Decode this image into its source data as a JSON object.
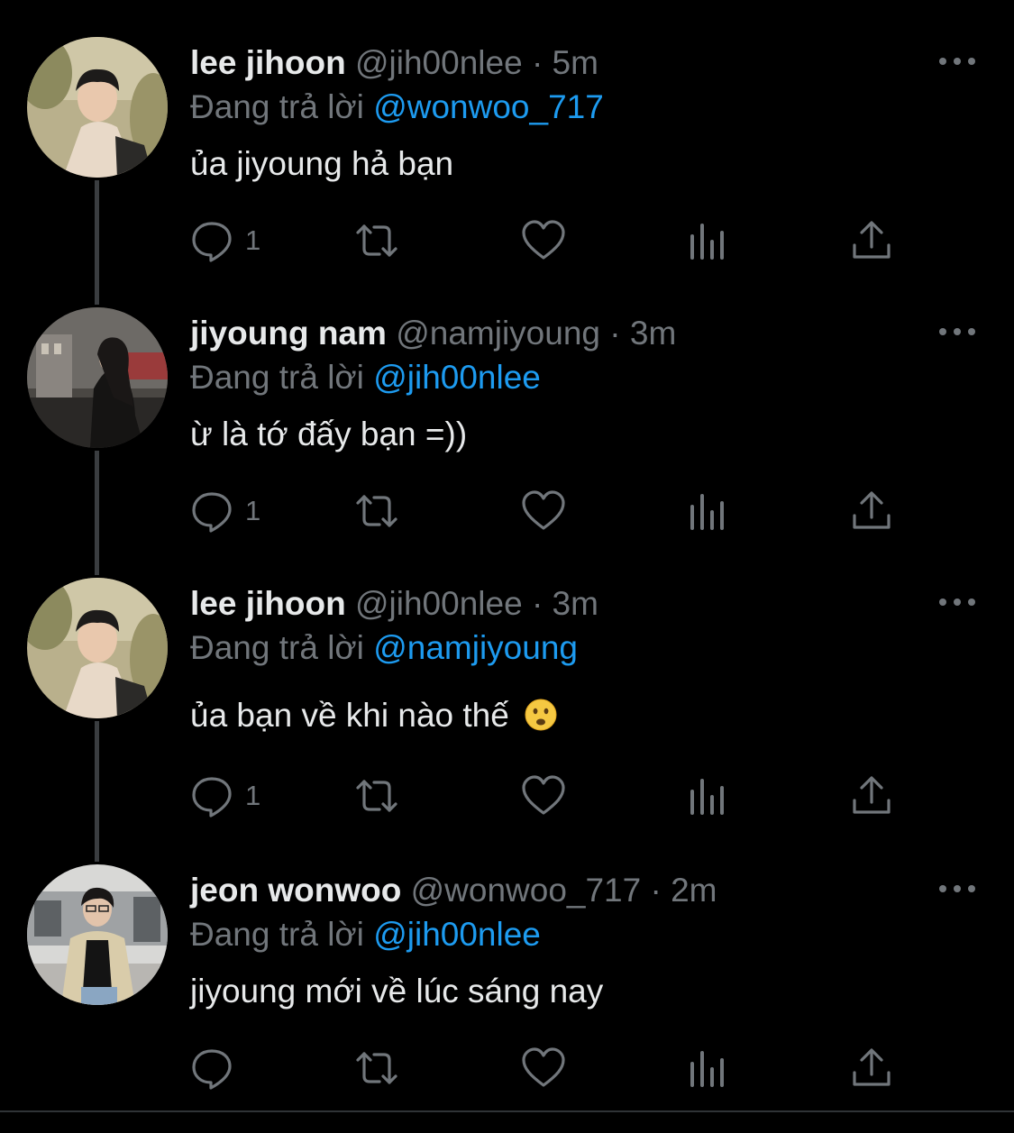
{
  "tweets": [
    {
      "name": "lee jihoon",
      "handle": "@jih00nlee",
      "dot": "·",
      "time": "5m",
      "reply_prefix": "Đang trả lời",
      "reply_to": "@wonwoo_717",
      "text": "ủa jiyoung hả bạn",
      "reply_count": "1",
      "avatar_icon": "avatar-photo-lee-jihoon"
    },
    {
      "name": "jiyoung nam",
      "handle": "@namjiyoung",
      "dot": "·",
      "time": "3m",
      "reply_prefix": "Đang trả lời",
      "reply_to": "@jih00nlee",
      "text": "ừ là tớ đấy bạn =))",
      "reply_count": "1",
      "avatar_icon": "avatar-photo-jiyoung-nam"
    },
    {
      "name": "lee jihoon",
      "handle": "@jih00nlee",
      "dot": "·",
      "time": "3m",
      "reply_prefix": "Đang trả lời",
      "reply_to": "@namjiyoung",
      "text": "ủa bạn về khi nào thế",
      "reply_count": "1",
      "emoji": "frowning-face-emoji",
      "avatar_icon": "avatar-photo-lee-jihoon"
    },
    {
      "name": "jeon wonwoo",
      "handle": "@wonwoo_717",
      "dot": "·",
      "time": "2m",
      "reply_prefix": "Đang trả lời",
      "reply_to": "@jih00nlee",
      "text": "jiyoung mới về lúc sáng nay",
      "reply_count": "",
      "avatar_icon": "avatar-photo-jeon-wonwoo"
    }
  ],
  "icons": {
    "reply": "reply-bubble-icon",
    "retweet": "retweet-icon",
    "like": "heart-icon",
    "views": "views-bar-chart-icon",
    "share": "share-upload-icon",
    "more": "more-dots-icon"
  },
  "colors": {
    "background": "#000000",
    "text": "#e7e9ea",
    "muted": "#71767b",
    "mention": "#1d9bf0",
    "thread_line": "#3a3d40"
  }
}
